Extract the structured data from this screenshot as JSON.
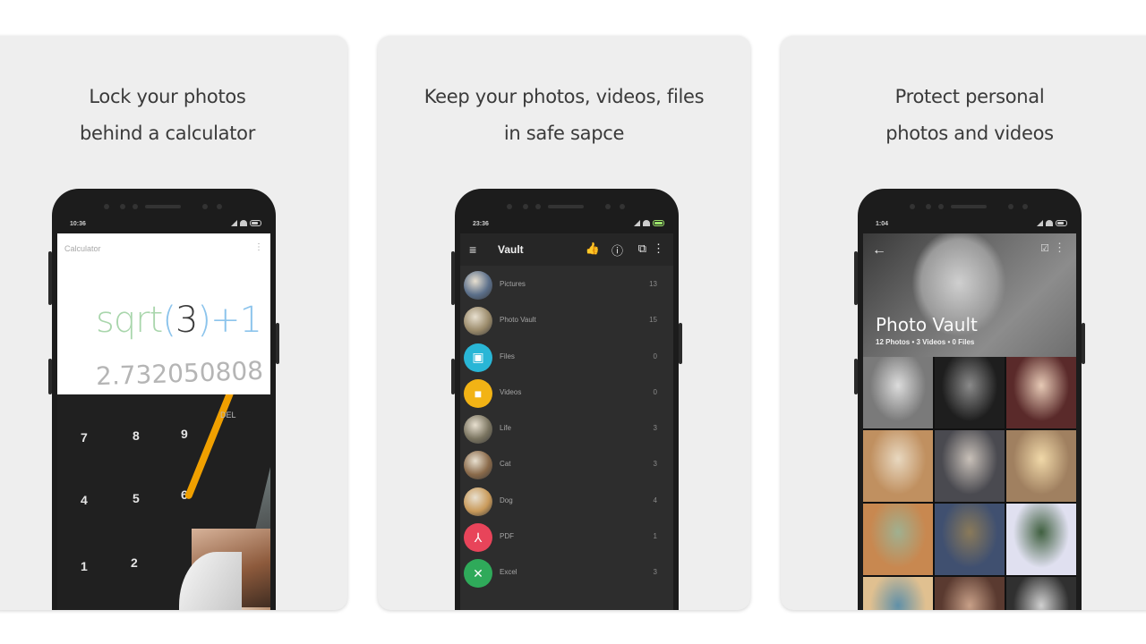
{
  "cards": [
    {
      "caption": [
        "Lock your photos",
        "behind a calculator"
      ],
      "phone": {
        "status_time": "10:36",
        "app_title": "Calculator",
        "menu_icon": "overflow-menu-icon",
        "expression": {
          "fn": "sqrt",
          "open": "(",
          "arg": "3",
          "close": ")",
          "op": "+1"
        },
        "result": "2.732050808",
        "keys": [
          "7",
          "8",
          "9",
          "4",
          "5",
          "6",
          "1",
          "2"
        ],
        "side_keys": [
          "DEL"
        ]
      }
    },
    {
      "caption": [
        "Keep your photos, videos, files",
        "in safe sapce"
      ],
      "phone": {
        "status_time": "23:36",
        "app_title": "Vault",
        "toolbar_icons": [
          "thumbs-up-icon",
          "info-icon",
          "import-icon",
          "overflow-menu-icon"
        ],
        "folders": [
          {
            "label": "Pictures",
            "count": "13",
            "icon": "photo-thumb",
            "color": "#5b6f8a"
          },
          {
            "label": "Photo Vault",
            "count": "15",
            "icon": "photo-thumb",
            "color": "#9a8a6a"
          },
          {
            "label": "Files",
            "count": "0",
            "icon": "folder-icon",
            "color": "#29b6d6"
          },
          {
            "label": "Videos",
            "count": "0",
            "icon": "video-icon",
            "color": "#f2b315"
          },
          {
            "label": "Life",
            "count": "3",
            "icon": "photo-thumb",
            "color": "#7a7460"
          },
          {
            "label": "Cat",
            "count": "3",
            "icon": "photo-thumb",
            "color": "#8a6a4a"
          },
          {
            "label": "Dog",
            "count": "4",
            "icon": "photo-thumb",
            "color": "#c99a5a"
          },
          {
            "label": "PDF",
            "count": "1",
            "icon": "pdf-icon",
            "color": "#e8445a"
          },
          {
            "label": "Excel",
            "count": "3",
            "icon": "excel-icon",
            "color": "#2faa5a"
          }
        ]
      }
    },
    {
      "caption": [
        "Protect personal",
        "photos and videos"
      ],
      "phone": {
        "status_time": "1:04",
        "album_title": "Photo Vault",
        "album_subtitle": "12 Photos • 3 Videos • 0 Files",
        "thumb_count": 12
      }
    }
  ],
  "glyphs": {
    "menu": "≡",
    "back": "←",
    "more": "⋮",
    "thumbs_up": "👍",
    "info": "ⓘ",
    "import": "⧉",
    "edit": "☑",
    "folder": "▣",
    "video": "■",
    "pdf": "⅄",
    "excel": "✕"
  }
}
